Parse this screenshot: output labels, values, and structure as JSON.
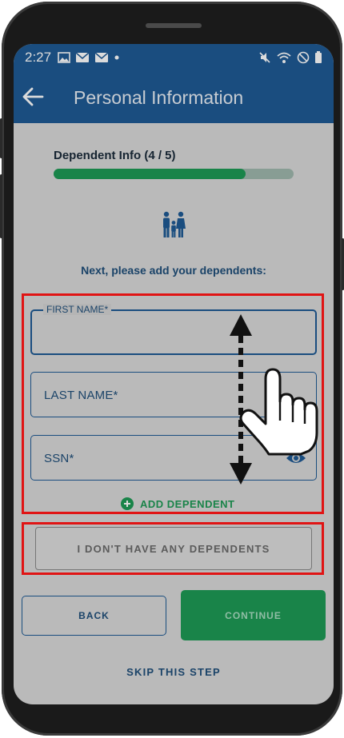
{
  "status_bar": {
    "time": "2:27",
    "left_icons": [
      "image-icon",
      "message-icon",
      "message-icon",
      "dot-icon"
    ],
    "right_icons": [
      "mute-icon",
      "wifi-icon",
      "do-not-disturb-icon",
      "battery-icon"
    ]
  },
  "app_bar": {
    "title": "Personal Information",
    "back_icon": "arrow-left-icon"
  },
  "progress": {
    "label": "Dependent Info (4 / 5)",
    "current": 4,
    "total": 5,
    "fill_fraction": 0.8
  },
  "illustration": {
    "icon": "family-icon"
  },
  "instruction": "Next, please add your dependents:",
  "form": {
    "first_name": {
      "label": "FIRST NAME*",
      "value": ""
    },
    "last_name": {
      "label": "LAST NAME*",
      "value": ""
    },
    "ssn": {
      "label": "SSN*",
      "value": "",
      "toggle_icon": "eye-icon"
    }
  },
  "add_dependent_label": "ADD DEPENDENT",
  "no_dependents_label": "I DON'T HAVE ANY DEPENDENTS",
  "back_label": "BACK",
  "continue_label": "CONTINUE",
  "skip_label": "SKIP THIS STEP",
  "annotation": {
    "gesture_icon": "hand-scroll-icon",
    "highlight_color": "#e01414"
  },
  "colors": {
    "brand_blue": "#1f5a94",
    "accent_green": "#1e9a55",
    "text_blue": "#1f4e7a"
  }
}
